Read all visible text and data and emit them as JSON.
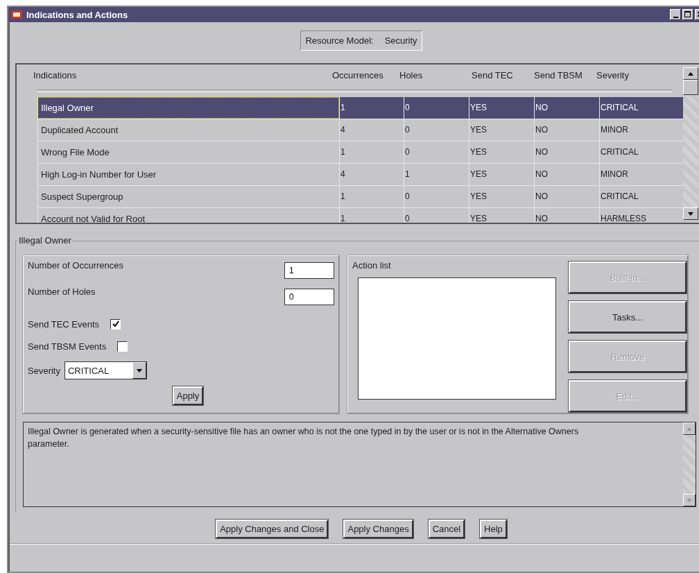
{
  "window": {
    "title": "Indications and Actions"
  },
  "resource_model": {
    "label": "Resource Model:",
    "value": "Security"
  },
  "table": {
    "columns": [
      "Indications",
      "Occurrences",
      "Holes",
      "Send TEC",
      "Send TBSM",
      "Severity"
    ],
    "rows": [
      {
        "cells": [
          "Illegal Owner",
          "1",
          "0",
          "YES",
          "NO",
          "CRITICAL"
        ],
        "selected": true
      },
      {
        "cells": [
          "Duplicated Account",
          "4",
          "0",
          "YES",
          "NO",
          "MINOR"
        ],
        "selected": false
      },
      {
        "cells": [
          "Wrong File Mode",
          "1",
          "0",
          "YES",
          "NO",
          "CRITICAL"
        ],
        "selected": false
      },
      {
        "cells": [
          "High Log-in Number for User",
          "4",
          "1",
          "YES",
          "NO",
          "MINOR"
        ],
        "selected": false
      },
      {
        "cells": [
          "Suspect Supergroup",
          "1",
          "0",
          "YES",
          "NO",
          "CRITICAL"
        ],
        "selected": false
      },
      {
        "cells": [
          "Account not Valid for Root",
          "1",
          "0",
          "YES",
          "NO",
          "HARMLESS"
        ],
        "selected": false
      }
    ]
  },
  "details": {
    "title": "Illegal Owner",
    "fields": [
      {
        "label": "Number of Occurrences",
        "value": "1"
      },
      {
        "label": "Number of Holes",
        "value": "0"
      }
    ],
    "checkboxes": [
      {
        "label": "Send TEC Events",
        "checked": true
      },
      {
        "label": "Send TBSM Events",
        "checked": false
      }
    ],
    "severity": {
      "label": "Severity",
      "value": "CRITICAL"
    },
    "apply": "Apply",
    "action_list": {
      "label": "Action list"
    },
    "action_buttons": [
      {
        "label": "Built-in...",
        "disabled": true
      },
      {
        "label": "Tasks...",
        "disabled": false
      },
      {
        "label": "Remove",
        "disabled": true
      },
      {
        "label": "Edit...",
        "disabled": true
      }
    ]
  },
  "description": "Illegal Owner is generated when a security-sensitive file has an owner who is not the one typed in by the user or is not in the Alternative Owners parameter.",
  "buttons": [
    "Apply Changes and Close",
    "Apply Changes",
    "Cancel",
    "Help"
  ]
}
